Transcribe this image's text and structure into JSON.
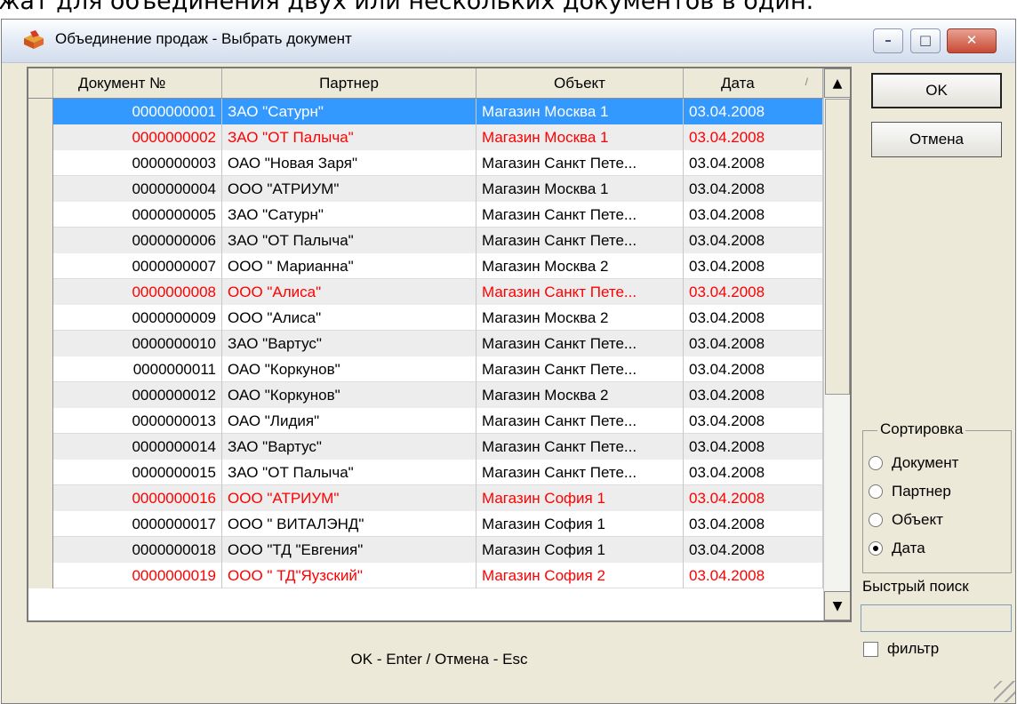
{
  "background_caption": "жат для объединения двух или нескольких документов в один.",
  "window": {
    "title": "Объединение продаж - Выбрать документ",
    "icon": "box-icon",
    "controls": {
      "minimize": "minimize-icon",
      "maximize": "maximize-icon",
      "close": "close-icon"
    }
  },
  "grid": {
    "columns": [
      "Документ №",
      "Партнер",
      "Объект",
      "Дата"
    ],
    "sort_indicator": "/",
    "selected_row": 0,
    "rows": [
      {
        "doc": "0000000001",
        "partner": "ЗАО \"Сатурн\"",
        "object": "Магазин Москва 1",
        "date": "03.04.2008",
        "red": false
      },
      {
        "doc": "0000000002",
        "partner": "ЗАО \"ОТ Палыча\"",
        "object": "Магазин Москва 1",
        "date": "03.04.2008",
        "red": true
      },
      {
        "doc": "0000000003",
        "partner": "ОАО \"Новая Заря\"",
        "object": "Магазин Санкт Пете...",
        "date": "03.04.2008",
        "red": false
      },
      {
        "doc": "0000000004",
        "partner": "ООО \"АТРИУМ\"",
        "object": "Магазин Москва 1",
        "date": "03.04.2008",
        "red": false
      },
      {
        "doc": "0000000005",
        "partner": "ЗАО \"Сатурн\"",
        "object": "Магазин Санкт Пете...",
        "date": "03.04.2008",
        "red": false
      },
      {
        "doc": "0000000006",
        "partner": "ЗАО \"ОТ Палыча\"",
        "object": "Магазин Санкт Пете...",
        "date": "03.04.2008",
        "red": false
      },
      {
        "doc": "0000000007",
        "partner": "ООО \" Марианна\"",
        "object": "Магазин Москва 2",
        "date": "03.04.2008",
        "red": false
      },
      {
        "doc": "0000000008",
        "partner": "ООО \"Алиса\"",
        "object": "Магазин Санкт Пете...",
        "date": "03.04.2008",
        "red": true
      },
      {
        "doc": "0000000009",
        "partner": "ООО \"Алиса\"",
        "object": "Магазин Москва 2",
        "date": "03.04.2008",
        "red": false
      },
      {
        "doc": "0000000010",
        "partner": "ЗАО \"Вартус\"",
        "object": "Магазин Санкт Пете...",
        "date": "03.04.2008",
        "red": false
      },
      {
        "doc": "0000000011",
        "partner": "ОАО \"Коркунов\"",
        "object": "Магазин Санкт Пете...",
        "date": "03.04.2008",
        "red": false
      },
      {
        "doc": "0000000012",
        "partner": "ОАО \"Коркунов\"",
        "object": "Магазин Москва 2",
        "date": "03.04.2008",
        "red": false
      },
      {
        "doc": "0000000013",
        "partner": "ОАО \"Лидия\"",
        "object": "Магазин Санкт Пете...",
        "date": "03.04.2008",
        "red": false
      },
      {
        "doc": "0000000014",
        "partner": "ЗАО \"Вартус\"",
        "object": "Магазин Санкт Пете...",
        "date": "03.04.2008",
        "red": false
      },
      {
        "doc": "0000000015",
        "partner": "ЗАО \"ОТ Палыча\"",
        "object": "Магазин Санкт Пете...",
        "date": "03.04.2008",
        "red": false
      },
      {
        "doc": "0000000016",
        "partner": "ООО \"АТРИУМ\"",
        "object": "Магазин София 1",
        "date": "03.04.2008",
        "red": true
      },
      {
        "doc": "0000000017",
        "partner": "ООО \" ВИТАЛЭНД\"",
        "object": "Магазин София 1",
        "date": "03.04.2008",
        "red": false
      },
      {
        "doc": "0000000018",
        "partner": "ООО \"ТД \"Евгения\"",
        "object": "Магазин София 1",
        "date": "03.04.2008",
        "red": false
      },
      {
        "doc": "0000000019",
        "partner": "ООО \" ТД\"Яузский\"",
        "object": "Магазин София 2",
        "date": "03.04.2008",
        "red": true
      }
    ]
  },
  "buttons": {
    "ok": "OK",
    "cancel": "Отмена"
  },
  "sorting": {
    "title": "Сортировка",
    "options": [
      {
        "label": "Документ",
        "checked": false
      },
      {
        "label": "Партнер",
        "checked": false
      },
      {
        "label": "Объект",
        "checked": false
      },
      {
        "label": "Дата",
        "checked": true
      }
    ]
  },
  "quick_search": {
    "label": "Быстрый поиск",
    "value": ""
  },
  "filter": {
    "label": "фильтр",
    "checked": false
  },
  "status": "OK - Enter / Отмена - Esc",
  "colors": {
    "selection": "#3399ff",
    "red_text": "#ff0000",
    "alt_row": "#ededed",
    "face": "#ece9d8"
  }
}
